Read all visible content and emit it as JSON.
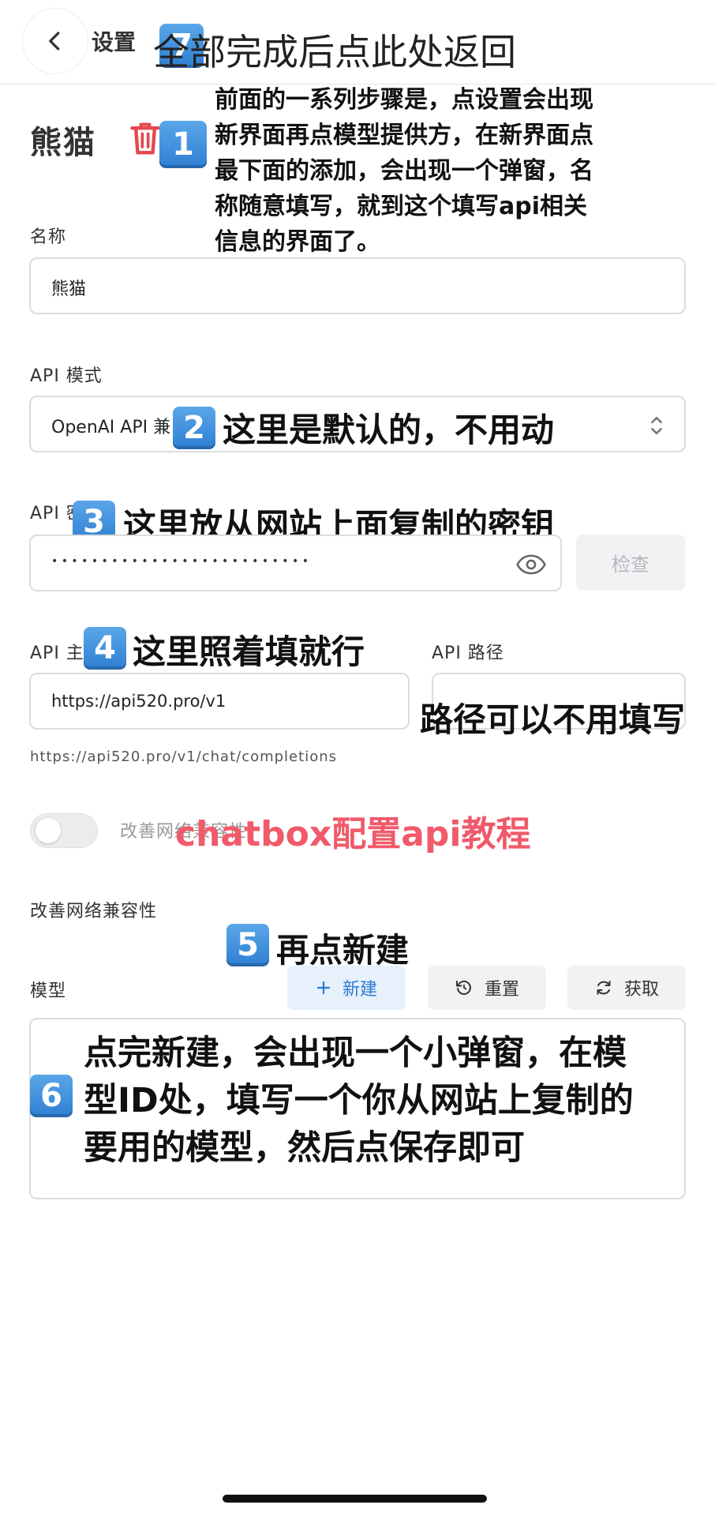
{
  "header": {
    "title": "设置",
    "step7_text": "全部完成后点此处返回"
  },
  "provider": {
    "name": "熊猫"
  },
  "annotations": {
    "step1_lines": [
      "前面的一系列步骤是，点设置会出现",
      "新界面再点模型提供方，在新界面点",
      "最下面的添加，会出现一个弹窗，名",
      "称随意填写，就到这个填写api相关",
      "信息的界面了。"
    ],
    "step2": "这里是默认的，不用动",
    "step3": "这里放从网站上面复制的密钥",
    "step4": "这里照着填就行",
    "path_note": "路径可以不用填写",
    "watermark": "chatbox配置api教程",
    "step5": "再点新建",
    "step6_lines": [
      "点完新建，会出现一个小弹窗，在模",
      "型ID处，填写一个你从网站上复制的",
      "要用的模型，然后点保存即可"
    ]
  },
  "badges": {
    "b1": "1",
    "b2": "2",
    "b3": "3",
    "b4": "4",
    "b5": "5",
    "b6": "6",
    "b7": "7"
  },
  "form": {
    "name_label": "名称",
    "name_value": "熊猫",
    "api_mode_label": "API 模式",
    "api_mode_value": "OpenAI API 兼",
    "api_key_label": "API 密钥",
    "api_key_masked": "•   •   •   •   •   •   •   •   •   •   •   •   •   •   •   •   •   •   •   •   •   •   •   •   •   •",
    "check_label": "检查",
    "api_host_label": "API 主机",
    "api_host_value": "https://api520.pro/v1",
    "api_path_label": "API 路径",
    "endpoint_hint": "https://api520.pro/v1/chat/completions",
    "toggle_label": "改善网络兼容性",
    "compat_label": "改善网络兼容性",
    "models_label": "模型",
    "new_label": "新建",
    "reset_label": "重置",
    "fetch_label": "获取"
  },
  "colors": {
    "watermark": "#f05a6a",
    "primary": "#2a7bd4",
    "badge": "#3a8ad9",
    "delete": "#e5484d"
  }
}
